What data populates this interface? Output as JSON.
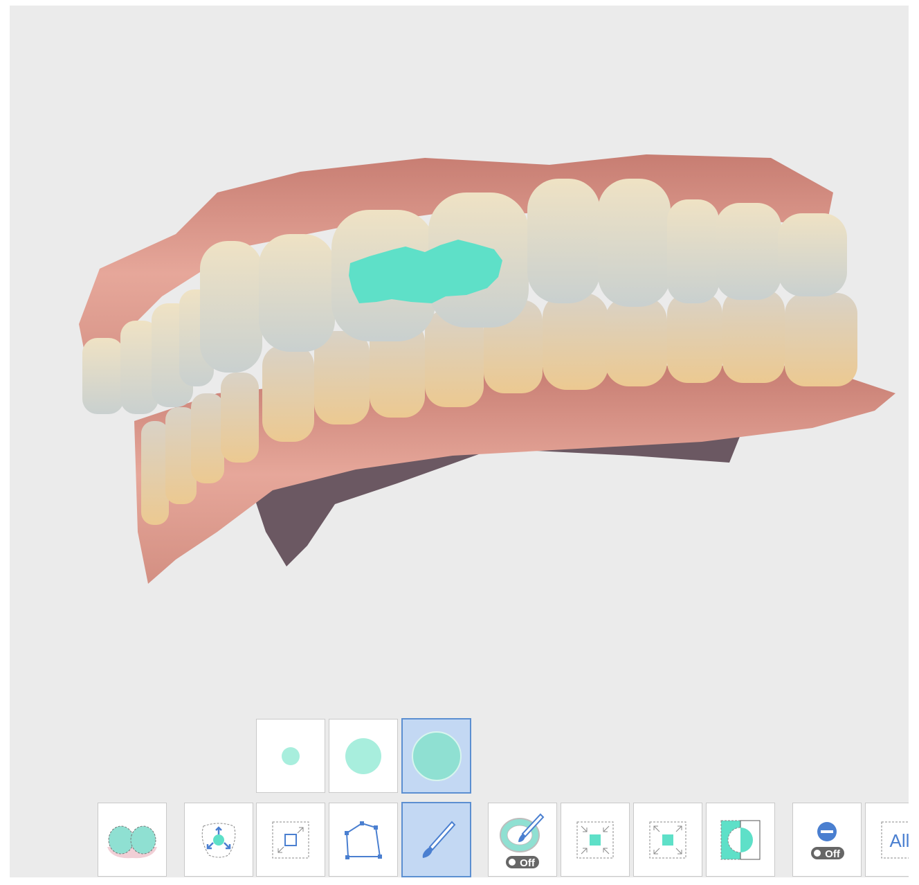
{
  "app": {
    "viewport": {
      "name": "3d-scan-viewport"
    }
  },
  "brush_sizes": [
    {
      "name": "small",
      "selected": false
    },
    {
      "name": "medium",
      "selected": false
    },
    {
      "name": "large",
      "selected": true
    }
  ],
  "toolbar": {
    "tools": [
      {
        "id": "jaw-selection",
        "icon": "jaw-teeth-icon",
        "active": false
      },
      {
        "id": "smart-selection",
        "icon": "expand-selection-icon",
        "active": false
      },
      {
        "id": "rectangle-selection",
        "icon": "rectangle-select-icon",
        "active": false
      },
      {
        "id": "polygon-selection",
        "icon": "polygon-select-icon",
        "active": false
      },
      {
        "id": "brush-selection",
        "icon": "brush-icon",
        "active": true
      },
      {
        "id": "fill-selection",
        "icon": "fill-brush-icon",
        "toggle_label": "Off",
        "active": false
      },
      {
        "id": "shrink-selection",
        "icon": "shrink-icon",
        "active": false
      },
      {
        "id": "grow-selection",
        "icon": "grow-icon",
        "active": false
      },
      {
        "id": "invert-selection",
        "icon": "invert-icon",
        "active": false
      },
      {
        "id": "deselect",
        "icon": "minus-circle-icon",
        "toggle_label": "Off",
        "active": false
      },
      {
        "id": "select-all",
        "icon": "select-all-icon",
        "label": "All",
        "active": false
      }
    ]
  },
  "colors": {
    "selection": "#5ee0c8",
    "active_bg": "#c3d8f3",
    "active_border": "#5b8fd1",
    "icon_blue": "#4a7fd0",
    "gum": "#d99a8c",
    "tooth": "#efd9b3"
  }
}
